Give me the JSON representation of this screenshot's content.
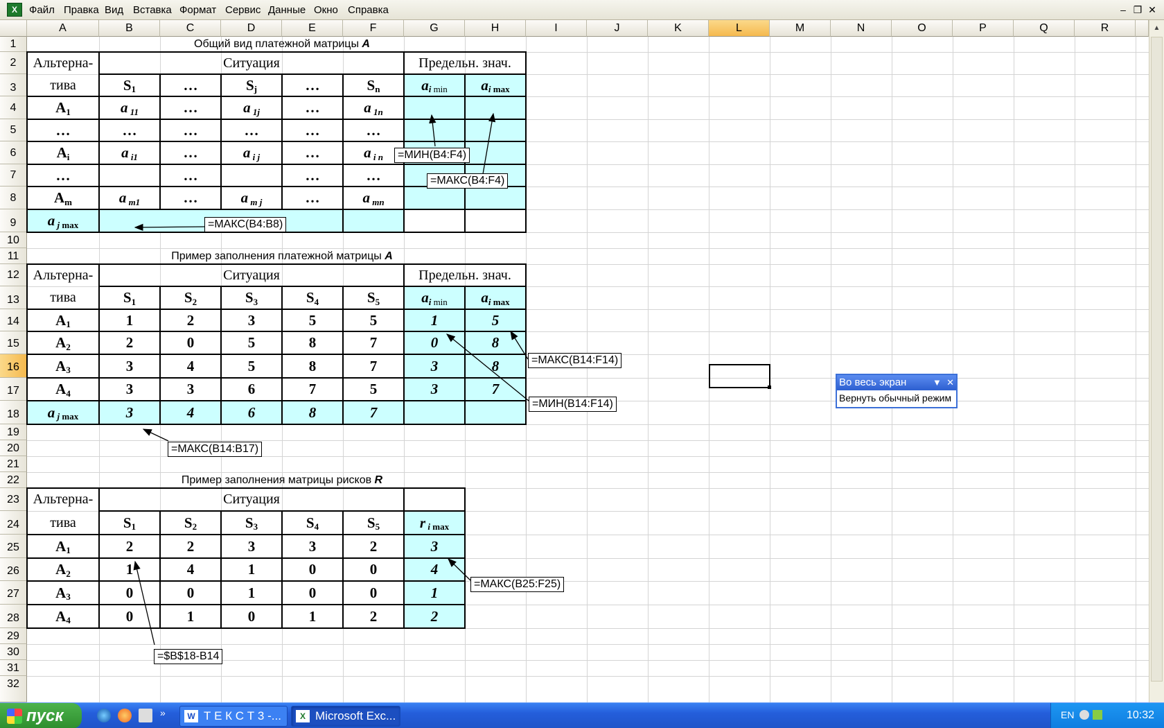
{
  "menu": {
    "items": [
      "Файл",
      "Правка",
      "Вид",
      "Вставка",
      "Формат",
      "Сервис",
      "Данные",
      "Окно",
      "Справка"
    ]
  },
  "columns": [
    "A",
    "B",
    "C",
    "D",
    "E",
    "F",
    "G",
    "H",
    "I",
    "J",
    "K",
    "L",
    "M",
    "N",
    "O",
    "P",
    "Q",
    "R"
  ],
  "rows": [
    "1",
    "2",
    "3",
    "4",
    "5",
    "6",
    "7",
    "8",
    "9",
    "10",
    "11",
    "12",
    "13",
    "14",
    "15",
    "16",
    "17",
    "18",
    "19",
    "20",
    "21",
    "22",
    "23",
    "24",
    "25",
    "26",
    "27",
    "28",
    "29",
    "30",
    "31",
    "32"
  ],
  "selection": {
    "column": "L",
    "row": "16"
  },
  "titles": {
    "t1": "Общий вид платежной матрицы",
    "t1v": "A",
    "t2": "Пример заполнения платежной матрицы",
    "t2v": "A",
    "t3": "Пример заполнения матрицы рисков",
    "t3v": "R"
  },
  "labels": {
    "alt1": "Альтерна-",
    "alt2": "тива",
    "situation": "Ситуация",
    "limits": "Предельн. знач.",
    "dots": "…"
  },
  "callouts": {
    "c1": "=МИН(B4:F4)",
    "c2": "=МАКС(B4:F4)",
    "c3": "=МАКС(B4:B8)",
    "c4": "=МАКС(B14:F14)",
    "c5": "=МИН(B14:F14)",
    "c6": "=МАКС(B14:B17)",
    "c7": "=МАКС(B25:F25)",
    "c8": "=$B$18-B14"
  },
  "matrix2": {
    "values": [
      [
        "1",
        "2",
        "3",
        "5",
        "5"
      ],
      [
        "2",
        "0",
        "5",
        "8",
        "7"
      ],
      [
        "3",
        "4",
        "5",
        "8",
        "7"
      ],
      [
        "3",
        "3",
        "6",
        "7",
        "5"
      ]
    ],
    "min": [
      "1",
      "0",
      "3",
      "3"
    ],
    "max": [
      "5",
      "8",
      "8",
      "7"
    ],
    "colmax": [
      "3",
      "4",
      "6",
      "8",
      "7"
    ]
  },
  "matrix3": {
    "values": [
      [
        "2",
        "2",
        "3",
        "3",
        "2"
      ],
      [
        "1",
        "4",
        "1",
        "0",
        "0"
      ],
      [
        "0",
        "0",
        "1",
        "0",
        "0"
      ],
      [
        "0",
        "1",
        "0",
        "1",
        "2"
      ]
    ],
    "rmax": [
      "3",
      "4",
      "1",
      "2"
    ]
  },
  "fullscreen": {
    "title": "Во весь экран",
    "restore": "Вернуть обычный режим"
  },
  "taskbar": {
    "start": "пуск",
    "task1": "Т Е К С Т 3 -...",
    "task2": "Microsoft Exc...",
    "lang": "EN",
    "clock": "10:32"
  }
}
